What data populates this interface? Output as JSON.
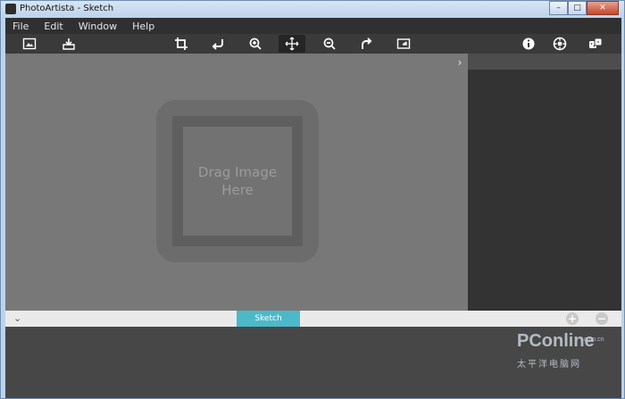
{
  "window": {
    "title": "PhotoArtista - Sketch",
    "buttons": [
      "–",
      "□",
      "✕"
    ]
  },
  "menubar": {
    "items": [
      "File",
      "Edit",
      "Window",
      "Help"
    ]
  },
  "toolbar": {
    "left": [
      {
        "name": "open-image-icon"
      },
      {
        "name": "save-icon"
      }
    ],
    "center": [
      {
        "name": "crop-icon"
      },
      {
        "name": "undo-icon"
      },
      {
        "name": "zoom-in-icon"
      },
      {
        "name": "move-icon",
        "active": true
      },
      {
        "name": "zoom-out-icon"
      },
      {
        "name": "redo-icon"
      },
      {
        "name": "fit-screen-icon"
      }
    ],
    "right": [
      {
        "name": "info-icon"
      },
      {
        "name": "settings-icon"
      },
      {
        "name": "random-icon"
      }
    ]
  },
  "canvas": {
    "placeholder": "Drag Image\nHere"
  },
  "bottom": {
    "tab_label": "Sketch"
  },
  "watermark": {
    "logo": "PConline",
    "domain": ".com.cn",
    "cn": "太平洋电脑网"
  },
  "colors": {
    "accent_tab": "#4cb9c9",
    "canvas": "#787878",
    "panel": "#333333"
  }
}
